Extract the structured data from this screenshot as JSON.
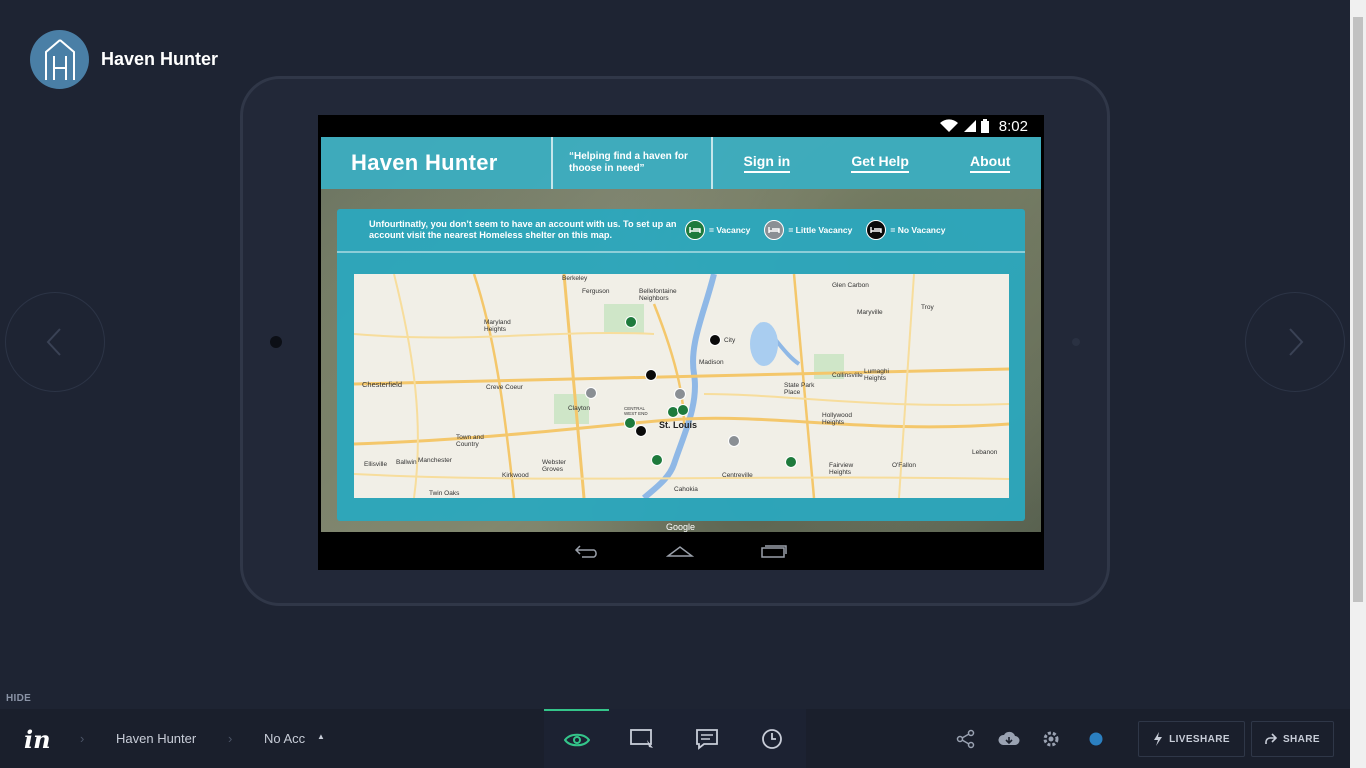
{
  "project": {
    "title": "Haven Hunter",
    "logo_letter": "H"
  },
  "device": {
    "status_time": "8:02"
  },
  "app": {
    "title": "Haven Hunter",
    "tagline": "“Helping find a haven for thoose in need”",
    "nav": [
      "Sign in",
      "Get Help",
      "About"
    ],
    "message": "Unfourtinatly, you don’t seem to have an account with us. To set up an account visit the nearest Homeless shelter on this map.",
    "legend": [
      {
        "label": "= Vacancy",
        "color": "#1e7a3c"
      },
      {
        "label": "= Little Vacancy",
        "color": "#8a8f94"
      },
      {
        "label": "= No Vacancy",
        "color": "#0a0a0a"
      }
    ],
    "map_labels": {
      "berkeley": "Berkeley",
      "ferguson": "Ferguson",
      "bellefontaine": "Bellefontaine Neighbors",
      "glen_carbon": "Glen Carbon",
      "troy": "Troy",
      "maryville": "Maryville",
      "maryland_heights": "Maryland Heights",
      "madison": "Madison",
      "granite_city": "City",
      "chesterfield": "Chesterfield",
      "creve_coeur": "Creve Coeur",
      "collinsville": "Collinsville",
      "lumaghi": "Lumaghi Heights",
      "state_park": "State Park Place",
      "clayton": "Clayton",
      "central_west_end": "CENTRAL WEST END",
      "st_louis": "St. Louis",
      "hollywood": "Hollywood Heights",
      "town_country": "Town and Country",
      "ballwin": "Ballwin",
      "manchester": "Manchester",
      "ellisville": "Ellisville",
      "webster": "Webster Groves",
      "kirkwood": "Kirkwood",
      "centreville": "Centreville",
      "fairview": "Fairview Heights",
      "ofallon": "O'Fallon",
      "lebanon": "Lebanon",
      "cahokia": "Cahokia",
      "twin_oaks": "Twin Oaks"
    },
    "map_credit": "Google"
  },
  "toolbar": {
    "hide_label": "HIDE",
    "logo": "in",
    "breadcrumb": [
      "Haven Hunter",
      "No Acc"
    ],
    "liveshare": "LIVESHARE",
    "share": "SHARE",
    "accent": "#34c58a"
  }
}
